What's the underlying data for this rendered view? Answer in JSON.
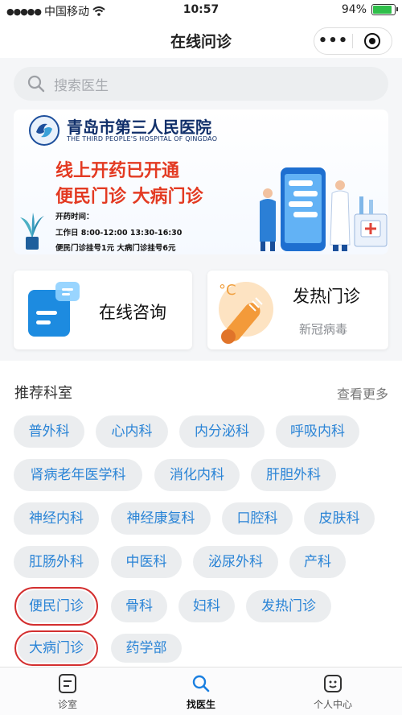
{
  "status_bar": {
    "carrier": "中国移动",
    "time": "10:57",
    "battery": "94%",
    "battery_level": 0.94
  },
  "navbar": {
    "title": "在线问诊",
    "more_label": "•••"
  },
  "search": {
    "placeholder": "搜索医生"
  },
  "banner": {
    "hospital_name": "青岛市第三人民医院",
    "hospital_name_en": "THE THIRD PEOPLE'S HOSPITAL OF QINGDAO",
    "headline": "线上开药已开通",
    "subheadline": "便民门诊 大病门诊",
    "hours_title": "开药时间：",
    "hours_detail": "工作日  8:00-12:00  13:30-16:30",
    "fees": "便民门诊挂号1元   大病门诊挂号6元"
  },
  "cards": {
    "online_consult": "在线咨询",
    "fever_clinic": "发热门诊",
    "fever_sub": "新冠病毒"
  },
  "departments": {
    "title": "推荐科室",
    "more": "查看更多",
    "items": [
      "普外科",
      "心内科",
      "内分泌科",
      "呼吸内科",
      "肾病老年医学科",
      "消化内科",
      "肝胆外科",
      "神经内科",
      "神经康复科",
      "口腔科",
      "皮肤科",
      "肛肠外科",
      "中医科",
      "泌尿外科",
      "产科",
      "便民门诊",
      "骨科",
      "妇科",
      "发热门诊",
      "大病门诊",
      "药学部"
    ]
  },
  "tabbar": {
    "items": [
      "诊室",
      "找医生",
      "个人中心"
    ],
    "active_index": 1
  },
  "colors": {
    "chip_text": "#2a84d6",
    "banner_red": "#e33a22",
    "highlight_box": "#d32f2f"
  }
}
